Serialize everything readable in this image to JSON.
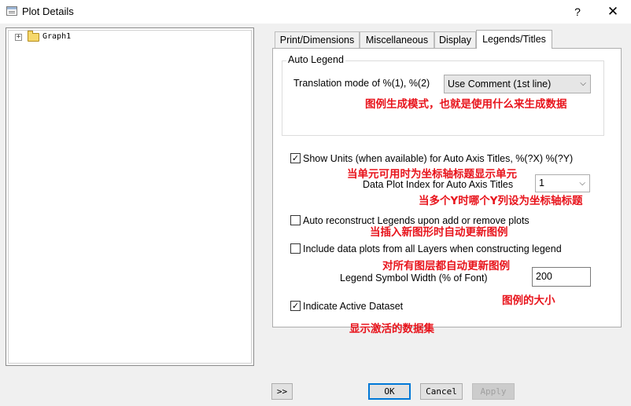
{
  "window": {
    "title": "Plot Details",
    "help": "?",
    "close": "✕"
  },
  "tree": {
    "expander": "+",
    "root_label": "Graph1"
  },
  "tabs": [
    {
      "label": "Print/Dimensions"
    },
    {
      "label": "Miscellaneous"
    },
    {
      "label": "Display"
    },
    {
      "label": "Legends/Titles"
    }
  ],
  "auto_legend": {
    "group_title": "Auto Legend",
    "translation_label": "Translation mode of %(1), %(2)",
    "translation_value": "Use Comment (1st line)",
    "translation_note": "图例生成模式，也就是使用什么来生成数据"
  },
  "show_units": {
    "label": "Show Units (when available) for Auto Axis Titles, %(?X)  %(?Y)",
    "checked_mark": "✓",
    "note": "当单元可用时为坐标轴标题显示单元"
  },
  "data_plot_index": {
    "label": "Data Plot Index for Auto Axis Titles",
    "value": "1",
    "note": "当多个Y时哪个Y列设为坐标轴标题"
  },
  "auto_reconstruct": {
    "label": "Auto reconstruct Legends upon add or remove plots",
    "note": "当插入新图形时自动更新图例"
  },
  "include_all_layers": {
    "label": "Include data plots from all Layers when constructing legend",
    "note": "对所有图层都自动更新图例"
  },
  "symbol_width": {
    "label": "Legend Symbol Width (% of Font)",
    "value": "200",
    "note": "图例的大小"
  },
  "indicate_active": {
    "label": "Indicate Active Dataset",
    "checked_mark": "✓",
    "note": "显示激活的数据集"
  },
  "buttons": {
    "more": ">>",
    "ok": "OK",
    "cancel": "Cancel",
    "apply": "Apply"
  }
}
